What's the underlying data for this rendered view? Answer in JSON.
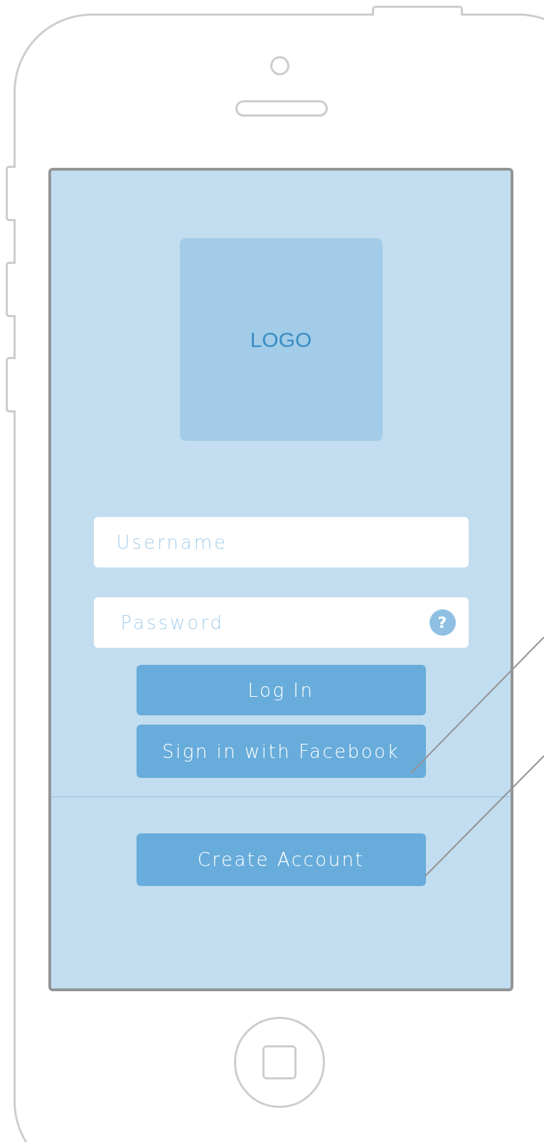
{
  "logo": {
    "label": "LOGO"
  },
  "fields": [
    {
      "placeholder": "Username"
    },
    {
      "placeholder": "Password",
      "help": "?"
    }
  ],
  "buttons": [
    {
      "label": "Log In"
    },
    {
      "label": "Sign in with Facebook"
    }
  ],
  "secondary_button": {
    "label": "Create Account"
  }
}
